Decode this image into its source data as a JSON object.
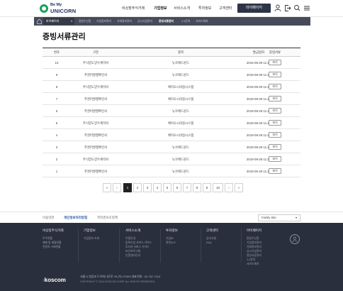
{
  "brand": {
    "line1": "Be My",
    "line2": "UNICORN"
  },
  "gnb": [
    "비상장주식거래",
    "기업정보",
    "서비스소개",
    "투자정보",
    "고객센터"
  ],
  "gnb_active_index": 1,
  "my_page_label": "마이페이지",
  "breadcrumb": {
    "selector": "마이페이지",
    "items": [
      "정정수신함",
      "기업정보관리",
      "거래정보관리",
      "공시기업관리",
      "증빙서류관리",
      "1:1문의",
      "서비스해지"
    ],
    "active_index": 4
  },
  "page_title": "증빙서류관리",
  "table": {
    "headers": [
      "번호",
      "구분",
      "종목",
      "발급일자",
      "증빙서류"
    ],
    "rows": [
      {
        "no": "10",
        "type": "주식양도양수계약서",
        "item": "뉴코애드윈드",
        "date": "2019-08-29 11:20",
        "action": "보기"
      },
      {
        "no": "9",
        "type": "주권미발행확인서",
        "item": "뉴코애드윈드",
        "date": "2019-08-29 11:20",
        "action": "보기"
      },
      {
        "no": "8",
        "type": "주식양도양수계약서",
        "item": "에이오시의정시스템",
        "date": "2019-08-29 11:20",
        "action": "보기"
      },
      {
        "no": "7",
        "type": "주권미발행확인서",
        "item": "에이오시의정시스템",
        "date": "2019-08-29 11:20",
        "action": "보기"
      },
      {
        "no": "6",
        "type": "주권미발행확인서",
        "item": "뉴코애드윈드",
        "date": "2019-08-29 11:20",
        "action": "보기"
      },
      {
        "no": "5",
        "type": "주식양도양수계약서",
        "item": "에이오시의정시스템",
        "date": "2019-08-29 11:20",
        "action": "보기"
      },
      {
        "no": "4",
        "type": "주권미발행확인서",
        "item": "에이오시의정시스템",
        "date": "2019-08-29 11:20",
        "action": "보기"
      },
      {
        "no": "3",
        "type": "주권미발행확인서",
        "item": "뉴코애드윈드",
        "date": "2019-08-29 11:20",
        "action": "보기"
      },
      {
        "no": "2",
        "type": "주식양도양수계약서",
        "item": "뉴코애드윈드",
        "date": "2019-08-29 11:20",
        "action": "보기"
      },
      {
        "no": "1",
        "type": "주권미발행확인서",
        "item": "뉴코애드윈드",
        "date": "2019-06-29 11:20",
        "action": "보기"
      }
    ]
  },
  "pagination": {
    "first": "«",
    "prev": "‹",
    "pages": [
      "1",
      "2",
      "3",
      "4",
      "5",
      "6",
      "7",
      "8",
      "9",
      "10"
    ],
    "next": "›",
    "last": "»",
    "current": "1"
  },
  "footer_links": {
    "terms": "이용약관",
    "privacy": "개인정보처리방침",
    "copyright": "저작권보호정책",
    "family_site": "Family Site"
  },
  "footer": {
    "columns": [
      {
        "title": "비상장주식거래",
        "items": [
          "주주현황",
          "매매 및 매출현황",
          "전종목 거래현황"
        ]
      },
      {
        "title": "기업정보",
        "items": [
          "기업정보 조회"
        ]
      },
      {
        "title": "서비스소개",
        "items": [
          "이용안내",
          "등록기업 서비스 가이드",
          "투자자 서비스 가이드",
          "보안프로그램",
          "인증센터안내"
        ]
      },
      {
        "title": "투자정보",
        "items": [
          "기업IR",
          "관련뉴스"
        ]
      },
      {
        "title": "고객센터",
        "items": [
          "공지사항",
          "FAQ"
        ]
      },
      {
        "title": "마이페이지",
        "items": [
          "알람수신함",
          "기업정보관리",
          "거래정보관리",
          "공시기업관리",
          "증빙서류관리",
          "1:1문의",
          "서비스해지"
        ]
      }
    ],
    "brand": "koscom",
    "address": "서울시 영등포구 여의나루로 76 (우) 07329   대표전화 : 02-767-7114",
    "copyright": "COPYRIGHT © 2019 KOSCOM CORP. ALL RIGHTS RESERVED."
  },
  "colors": {
    "brand_green": "#1aa05a",
    "dark_nav": "#2d3449",
    "footer_bg": "#2a2f3d",
    "link_blue": "#2054a8"
  }
}
